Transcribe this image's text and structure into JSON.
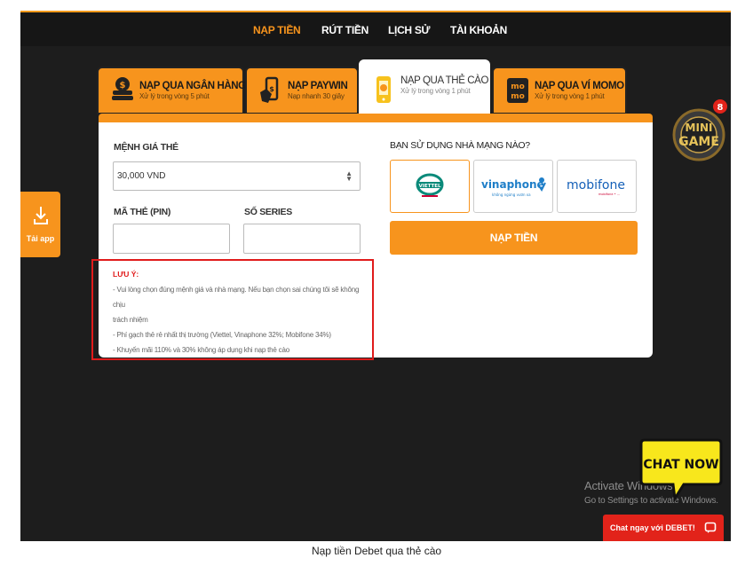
{
  "nav": {
    "items": [
      "NẠP TIỀN",
      "RÚT TIỀN",
      "LỊCH SỬ",
      "TÀI KHOẢN"
    ],
    "active": 0
  },
  "tabs": [
    {
      "title": "NẠP QUA NGÂN HÀNG",
      "subtitle": "Xử lý trong vòng 5 phút",
      "icon": "bank-coins-icon"
    },
    {
      "title": "NẠP PAYWIN",
      "subtitle": "Nạp nhanh 30 giây",
      "icon": "phone-hand-icon"
    },
    {
      "title": "NẠP QUA THẺ CÀO",
      "subtitle": "Xử lý trong vòng 1 phút",
      "icon": "phone-card-icon"
    },
    {
      "title": "NẠP QUA VÍ MOMO",
      "subtitle": "Xử lý trong vòng 1 phút",
      "icon": "momo-icon"
    }
  ],
  "form": {
    "denomination_label": "MỆNH GIÁ THẺ",
    "denomination_value": "30,000 VND",
    "pin_label": "MÃ THẺ (PIN)",
    "pin_value": "",
    "serial_label": "SỐ SERIES",
    "serial_value": "",
    "carrier_question": "BẠN SỬ DỤNG NHÀ MẠNG NÀO?",
    "carriers": [
      "viettel",
      "vinaphone",
      "mobifone"
    ],
    "submit_label": "NẠP TIỀN"
  },
  "note": {
    "heading": "LƯU Ý:",
    "line1": "- Vui lòng chọn đúng mệnh giá và nhà mạng. Nếu bạn chọn sai chúng tôi sẽ không chịu",
    "line2": "trách nhiệm",
    "line3": "- Phí gạch thẻ rẻ nhất thị trường (Viettel, Vinaphone 32%; Mobifone 34%)",
    "line4": "- Khuyến mãi 110% và 30% không áp dụng khi nạp thẻ cào"
  },
  "side": {
    "tai_app": "Tải app"
  },
  "minigame": {
    "badge": "8",
    "line1": "MINI",
    "line2": "GAME"
  },
  "chat": {
    "bubble": "CHAT NOW",
    "bar": "Chat ngay với DEBET!"
  },
  "activate": {
    "line1": "Activate Windows",
    "line2": "Go to Settings to activate Windows."
  },
  "caption": "Nạp tiền Debet qua thẻ cào",
  "colors": {
    "accent": "#f7941d",
    "dark": "#1d1d1d",
    "red": "#e01b1b"
  }
}
